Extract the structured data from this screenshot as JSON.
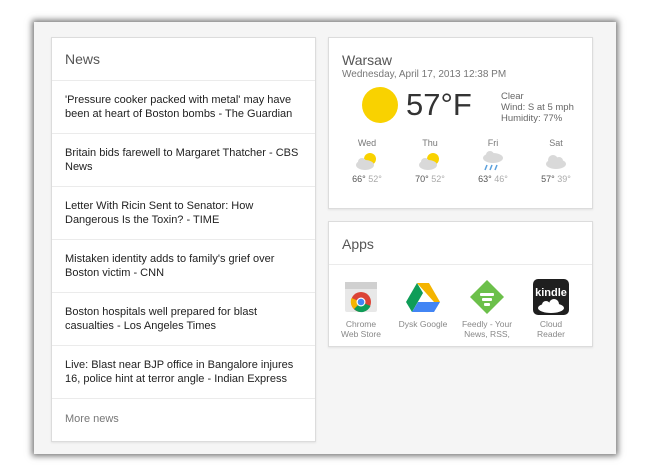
{
  "news": {
    "title": "News",
    "items": [
      "'Pressure cooker packed with metal' may have been at heart of Boston bombs - The Guardian",
      "Britain bids farewell to Margaret Thatcher - CBS News",
      "Letter With Ricin Sent to Senator: How Dangerous Is the Toxin? - TIME",
      "Mistaken identity adds to family's grief over Boston victim - CNN",
      "Boston hospitals well prepared for blast casualties - Los Angeles Times",
      "Live: Blast near BJP office in Bangalore injures 16, police hint at terror angle - Indian Express"
    ],
    "more_label": "More news"
  },
  "weather": {
    "city": "Warsaw",
    "datetime": "Wednesday, April 17, 2013 12:38 PM",
    "temperature": "57°F",
    "condition": "Clear",
    "wind": "Wind: S at 5 mph",
    "humidity": "Humidity: 77%",
    "current_icon": "sun-icon",
    "forecast": [
      {
        "day": "Wed",
        "high": "66°",
        "low": "52°",
        "icon": "partly-cloudy-icon"
      },
      {
        "day": "Thu",
        "high": "70°",
        "low": "52°",
        "icon": "partly-cloudy-icon"
      },
      {
        "day": "Fri",
        "high": "63°",
        "low": "46°",
        "icon": "rain-icon"
      },
      {
        "day": "Sat",
        "high": "57°",
        "low": "39°",
        "icon": "cloudy-icon"
      }
    ],
    "colors": {
      "sun": "#f9d200",
      "cloud": "#d9d9d9",
      "rain": "#5aa0dc"
    }
  },
  "apps": {
    "title": "Apps",
    "items": [
      {
        "label": "Chrome\nWeb Store",
        "icon": "chrome-web-store-icon"
      },
      {
        "label": "Dysk Google",
        "icon": "google-drive-icon"
      },
      {
        "label": "Feedly - Your\nNews, RSS,",
        "icon": "feedly-icon"
      },
      {
        "label": "Cloud\nReader",
        "icon": "kindle-icon"
      }
    ]
  }
}
